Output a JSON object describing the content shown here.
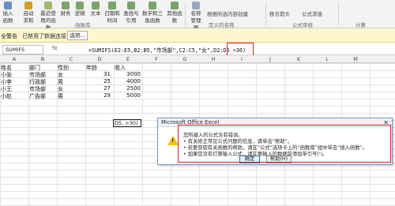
{
  "ribbon": {
    "buttons": [
      {
        "label": "插入函数",
        "name": "insert-function-button"
      },
      {
        "label": "自动求和",
        "name": "autosum-button"
      },
      {
        "label": "最近使用的函数",
        "name": "recent-functions-button"
      },
      {
        "label": "财务",
        "name": "financial-button"
      },
      {
        "label": "逻辑",
        "name": "logical-button"
      },
      {
        "label": "文本",
        "name": "text-button"
      },
      {
        "label": "日期和时间",
        "name": "datetime-button"
      },
      {
        "label": "查找与引用",
        "name": "lookup-button"
      },
      {
        "label": "数学和三角函数",
        "name": "math-button"
      },
      {
        "label": "其他函数",
        "name": "more-functions-button"
      },
      {
        "label": "名称管理器",
        "name": "name-manager-button"
      }
    ],
    "small_items": [
      "根据所选内容创建",
      "移去箭头",
      "公式求值"
    ],
    "groups": [
      "函数库",
      "定义的名称",
      "公式审核",
      "计算"
    ],
    "accent": "#2f6db5"
  },
  "security_bar": {
    "warning": "全警告",
    "message": "已禁用了数据连接",
    "options_label": "选项..."
  },
  "formula_bar": {
    "name_box": "SUMIFS",
    "fx": "fx",
    "formula": "=SUMIFS(E2:E5,B2:B5,\"市场部\",C2:C5,\"女\",D2:D5 >30)"
  },
  "columns": [
    "A",
    "B",
    "C",
    "D",
    "E",
    "F",
    "G",
    "H",
    "I",
    "J",
    "K",
    "L",
    "M"
  ],
  "table": {
    "headers": [
      "姓名",
      "部门",
      "性别",
      "年龄",
      "收入"
    ],
    "rows": [
      {
        "name": "小张",
        "dept": "市场部",
        "sex": "女",
        "age": "31",
        "income": "3000"
      },
      {
        "name": "小李",
        "dept": "行政部",
        "sex": "男",
        "age": "25",
        "income": "4000"
      },
      {
        "name": "小王",
        "dept": "市场部",
        "sex": "女",
        "age": "27",
        "income": "2500"
      },
      {
        "name": "小赵",
        "dept": "广告部",
        "sex": "男",
        "age": "29",
        "income": "5000"
      }
    ],
    "active_cell_text": "D5, >30)"
  },
  "dialog": {
    "title": "Microsoft Office Excel",
    "lines": [
      "您所键入的公式含有错误。",
      "• 有关修正常见公式问题的信息，请单击“帮助”。",
      "• 若要获取有关函数的帮助，请在“公式”选项卡上的“函数库”组中单击“插入函数”。",
      "• 如果您没有打算输入公式，请在要输入的数据前添加单引号(')。"
    ],
    "ok_label": "确定",
    "help_label": "帮助(H)"
  }
}
